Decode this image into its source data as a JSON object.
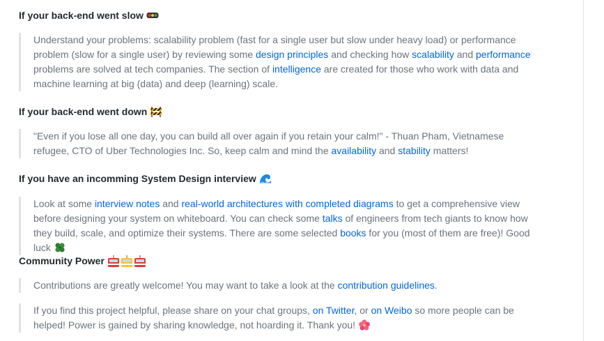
{
  "sections": [
    {
      "heading": "If your back-end went slow",
      "heading_icon": "traffic-light-icon",
      "quote": {
        "t1": "Understand your problems: scalability problem (fast for a single user but slow under heavy load) or performance problem (slow for a single user) by reviewing some ",
        "l1": "design principles",
        "t2": " and checking how ",
        "l2": "scalability",
        "t3": " and ",
        "l3": "performance",
        "t4": " problems are solved at tech companies. The section of ",
        "l4": "intelligence",
        "t5": " are created for those who work with data and machine learning at big (data) and deep (learning) scale."
      }
    },
    {
      "heading": "If your back-end went down",
      "heading_icon": "construction-barrier-icon",
      "quote": {
        "t1": "\"Even if you lose all one day, you can build all over again if you retain your calm!\" - Thuan Pham, Vietnamese refugee, CTO of Uber Technologies Inc. So, keep calm and mind the ",
        "l1": "availability",
        "t2": " and ",
        "l2": "stability",
        "t3": " matters!"
      }
    },
    {
      "heading": "If you have an incomming System Design interview",
      "heading_icon": "water-wave-icon",
      "quote": {
        "t1": "Look at some ",
        "l1": "interview notes",
        "t2": " and ",
        "l2": "real-world architectures with completed diagrams",
        "t3": " to get a comprehensive view before designing your system on whiteboard. You can check some ",
        "l3": "talks",
        "t4": " of engineers from tech giants to know how they build, scale, and optimize their systems. There are some selected ",
        "l4": "books",
        "t5": " for you (most of them are free)! Good luck",
        "end_icon": "four-leaf-clover-icon"
      }
    },
    {
      "heading": "Community Power",
      "heading_icon": "tram-cars-icon",
      "quote1": {
        "t1": "Contributions are greatly welcome! You may want to take a look at the ",
        "l1": "contribution guidelines",
        "t2": "."
      },
      "quote2": {
        "t1": "If you find this project helpful, please share on your chat groups, ",
        "l1": "on Twitter",
        "t2": ", or ",
        "l2": "on Weibo",
        "t3": " so more people can be helped! Power is gained by sharing knowledge, not hoarding it. Thank you!",
        "end_icon": "hibiscus-flower-icon"
      }
    }
  ],
  "colors": {
    "link": "#0366d6",
    "quote_text": "#6a737d",
    "quote_border": "#dfe2e5",
    "heading": "#24292e"
  }
}
